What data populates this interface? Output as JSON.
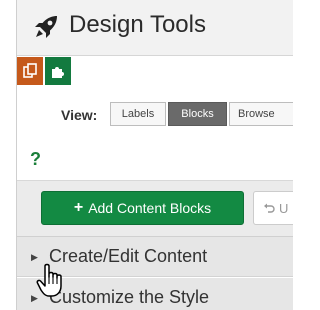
{
  "header": {
    "title": "Design Tools",
    "icon": "rocket-icon"
  },
  "tool_tabs": [
    {
      "icon": "copy-icon",
      "color": "#c5591b"
    },
    {
      "icon": "puzzle-icon",
      "color": "#137a3f"
    }
  ],
  "view": {
    "label": "View:",
    "options": [
      "Labels",
      "Blocks",
      "Browse"
    ],
    "selected": "Blocks"
  },
  "help": {
    "text": "?"
  },
  "actions": {
    "add_label": "Add Content Blocks",
    "add_icon": "plus-icon",
    "undo_label": "U",
    "undo_icon": "undo-icon"
  },
  "sections": [
    {
      "label": "Create/Edit Content"
    },
    {
      "label": "Customize the Style"
    }
  ],
  "colors": {
    "accent_green": "#138a43",
    "accent_orange": "#c5591b",
    "selected_segment": "#6a6a6a"
  }
}
